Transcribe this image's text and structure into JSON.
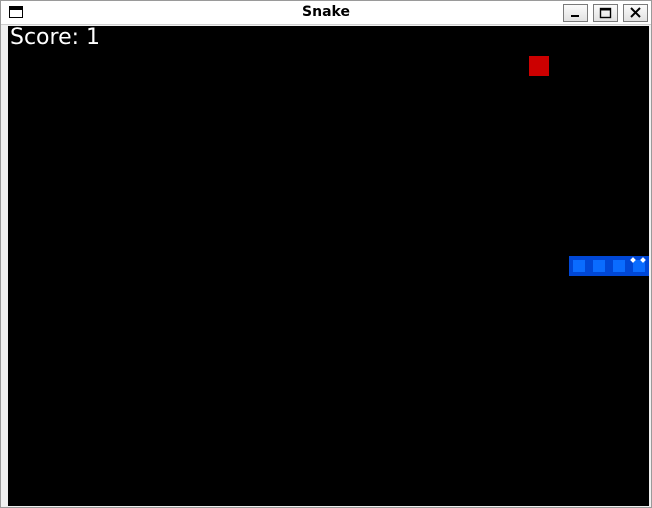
{
  "window": {
    "title": "Snake"
  },
  "game": {
    "score_text": "Score: 1",
    "background_color": "#000000",
    "food": {
      "col": 26,
      "row": 2,
      "color": "#cc0000"
    },
    "snake": {
      "body_color": "#0a6cff",
      "border_color": "#0047d6",
      "segments": [
        {
          "col": 31,
          "row": 12
        },
        {
          "col": 30,
          "row": 12
        },
        {
          "col": 29,
          "row": 12
        },
        {
          "col": 28,
          "row": 12
        }
      ]
    }
  }
}
